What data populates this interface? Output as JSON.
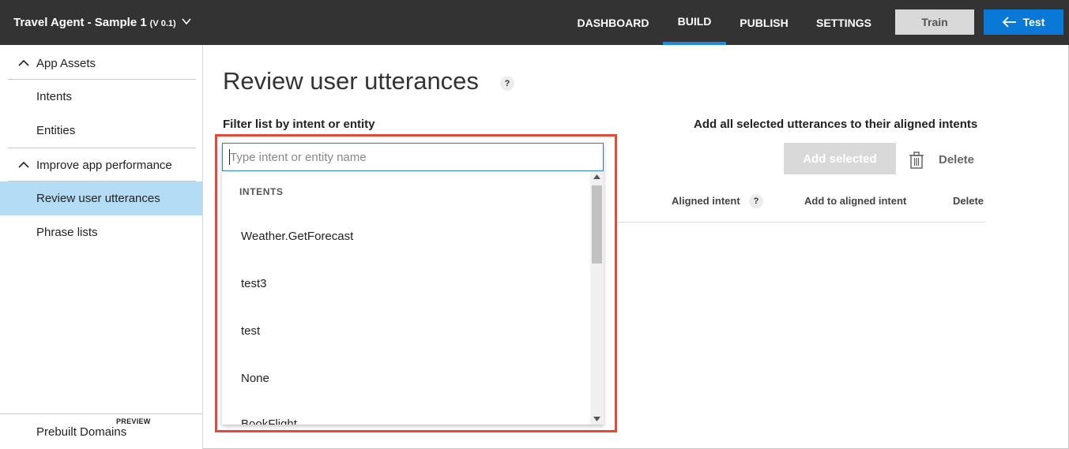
{
  "header": {
    "app_title": "Travel Agent - Sample 1",
    "app_version": "(V 0.1)",
    "nav": [
      {
        "label": "DASHBOARD",
        "active": false
      },
      {
        "label": "BUILD",
        "active": true
      },
      {
        "label": "PUBLISH",
        "active": false
      },
      {
        "label": "SETTINGS",
        "active": false
      }
    ],
    "train_label": "Train",
    "test_label": "Test"
  },
  "sidebar": {
    "sections": [
      {
        "label": "App Assets",
        "expanded": true,
        "items": [
          "Intents",
          "Entities"
        ]
      },
      {
        "label": "Improve app performance",
        "expanded": true,
        "items": [
          "Review user utterances",
          "Phrase lists"
        ]
      }
    ],
    "active_item": "Review user utterances",
    "bottom_badge": "PREVIEW",
    "bottom_label": "Prebuilt Domains"
  },
  "main": {
    "title": "Review user utterances",
    "help_mark": "?",
    "filter_label": "Filter list by intent or entity",
    "add_all_label": "Add all selected utterances to their aligned intents",
    "add_selected_label": "Add selected",
    "delete_label": "Delete",
    "columns": {
      "aligned_intent": "Aligned intent",
      "add_to_aligned": "Add to aligned intent",
      "delete": "Delete"
    }
  },
  "dropdown": {
    "placeholder": "Type intent or entity name",
    "value": "",
    "group_header": "INTENTS",
    "options": [
      "Weather.GetForecast",
      "test3",
      "test",
      "None",
      "BookFlight"
    ]
  },
  "colors": {
    "topbar_bg": "#333333",
    "accent": "#0a78d7",
    "active_tab_underline": "#1e88e5",
    "sidebar_active_bg": "#b5dcf5",
    "highlight_border": "#e04b3c"
  }
}
